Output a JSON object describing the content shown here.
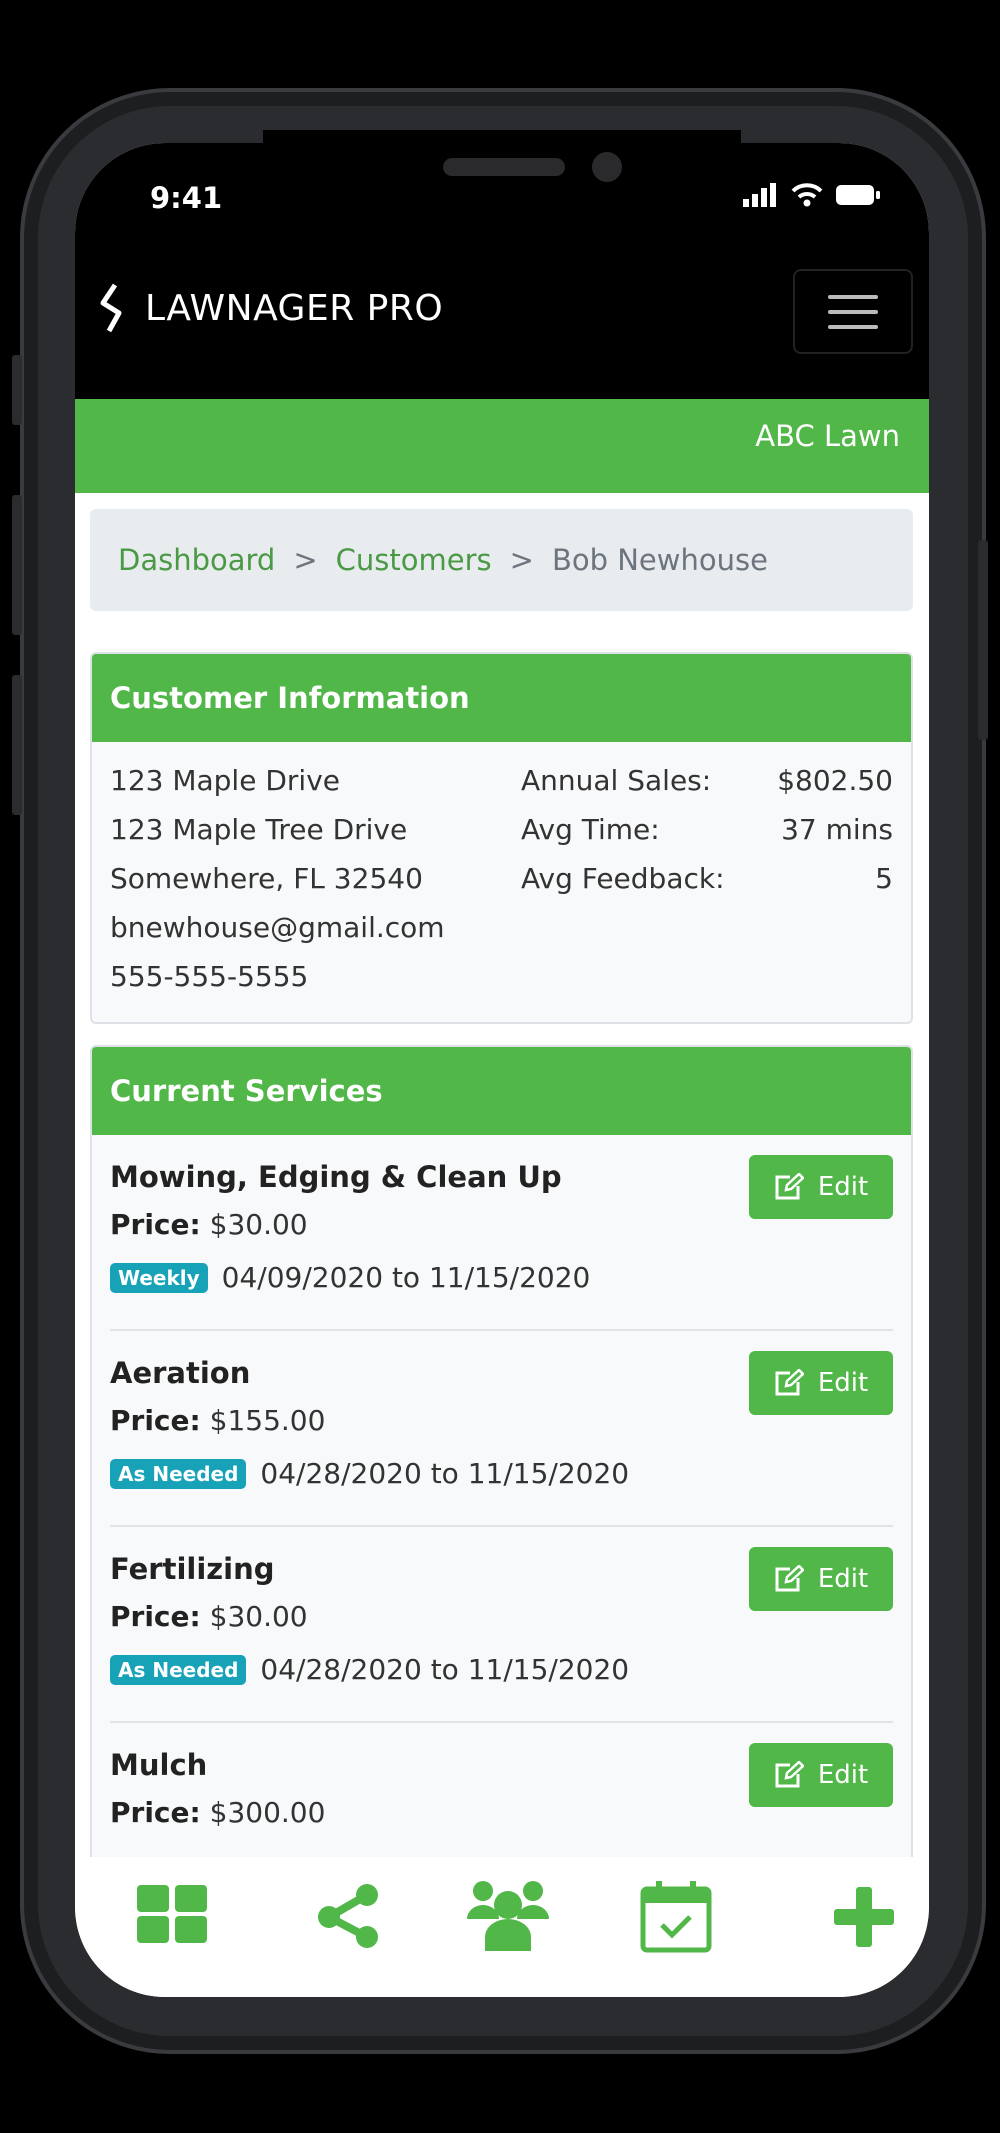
{
  "status_bar": {
    "time": "9:41"
  },
  "header": {
    "app_name": "LAWNAGER PRO",
    "company": "ABC Lawn"
  },
  "breadcrumb": {
    "items": [
      "Dashboard",
      "Customers",
      "Bob Newhouse"
    ],
    "separator": ">"
  },
  "customer_info": {
    "title": "Customer Information",
    "address_lines": [
      "123 Maple Drive",
      "123 Maple Tree Drive",
      "Somewhere, FL 32540",
      "bnewhouse@gmail.com",
      "555-555-5555"
    ],
    "stats": [
      {
        "label": "Annual Sales:",
        "value": "$802.50"
      },
      {
        "label": "Avg Time:",
        "value": "37 mins"
      },
      {
        "label": "Avg Feedback:",
        "value": "5"
      }
    ]
  },
  "current_services": {
    "title": "Current Services",
    "price_label": "Price:",
    "edit_label": "Edit",
    "items": [
      {
        "name": "Mowing, Edging & Clean Up",
        "price": "$30.00",
        "frequency": "Weekly",
        "dates": "04/09/2020 to 11/15/2020"
      },
      {
        "name": "Aeration",
        "price": "$155.00",
        "frequency": "As Needed",
        "dates": "04/28/2020 to 11/15/2020"
      },
      {
        "name": "Fertilizing",
        "price": "$30.00",
        "frequency": "As Needed",
        "dates": "04/28/2020 to 11/15/2020"
      },
      {
        "name": "Mulch",
        "price": "$300.00",
        "frequency": "",
        "dates": ""
      }
    ]
  },
  "bottom_nav": [
    "dashboard-grid-icon",
    "share-icon",
    "users-icon",
    "calendar-check-icon",
    "plus-icon"
  ],
  "colors": {
    "brand_green": "#50b748",
    "badge_teal": "#17a2b8",
    "link_green": "#4a9a45"
  }
}
